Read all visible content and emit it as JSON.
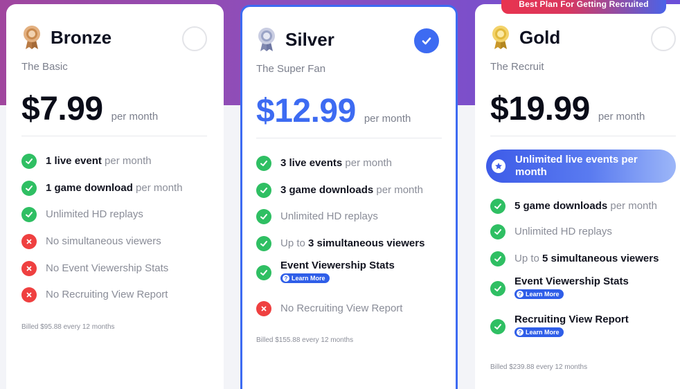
{
  "banner": "Best Plan For Getting Recruited",
  "plans": {
    "bronze": {
      "name": "Bronze",
      "subtitle": "The Basic",
      "price": "$7.99",
      "per": "per month",
      "features": [
        {
          "bold": "1 live event",
          "rest": " per month",
          "status": "ok"
        },
        {
          "bold": "1 game download",
          "rest": " per month",
          "status": "ok"
        },
        {
          "bold": "",
          "rest": "Unlimited HD replays",
          "status": "ok"
        },
        {
          "bold": "",
          "rest": "No simultaneous viewers",
          "status": "no"
        },
        {
          "bold": "",
          "rest": "No Event Viewership Stats",
          "status": "no"
        },
        {
          "bold": "",
          "rest": "No Recruiting View Report",
          "status": "no"
        }
      ],
      "billed": "Billed $95.88 every 12 months",
      "medal_color": "#c98a4e"
    },
    "silver": {
      "name": "Silver",
      "subtitle": "The Super Fan",
      "price": "$12.99",
      "per": "per month",
      "f1_bold": "3 live events",
      "f1_rest": " per month",
      "f2_bold": "3 game downloads",
      "f2_rest": " per month",
      "f3": "Unlimited HD replays",
      "f4_pre": "Up to ",
      "f4_bold": "3 simultaneous viewers",
      "f5": "Event Viewership Stats",
      "f6": "No Recruiting View Report",
      "learn_more": "Learn More",
      "billed": "Billed $155.88 every 12 months",
      "medal_color": "#9aa3c6"
    },
    "gold": {
      "name": "Gold",
      "subtitle": "The Recruit",
      "price": "$19.99",
      "per": "per month",
      "unlimited_1": "Unlimited live events per",
      "unlimited_2": "month",
      "f2_bold": "5 game downloads",
      "f2_rest": " per month",
      "f3": "Unlimited HD replays",
      "f4_pre": "Up to ",
      "f4_bold": "5 simultaneous viewers",
      "f5": "Event Viewership Stats",
      "f6": "Recruiting View Report",
      "learn_more": "Learn More",
      "billed": "Billed $239.88 every 12 months",
      "medal_color": "#e2b93b"
    }
  },
  "colors": {
    "accent": "#3d6bf2",
    "ok": "#2fbf63",
    "no": "#ef4040"
  }
}
